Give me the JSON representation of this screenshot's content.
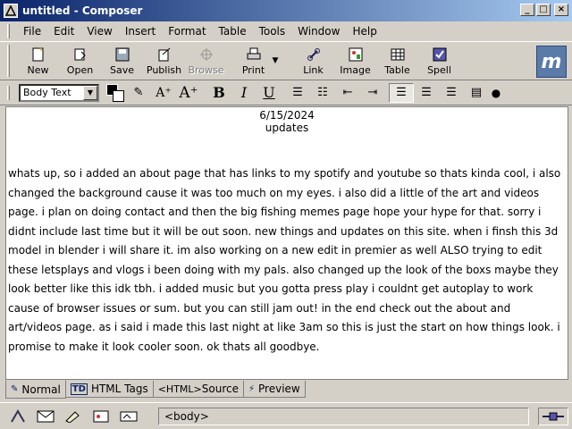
{
  "window": {
    "title": "untitled - Composer"
  },
  "menu": [
    "File",
    "Edit",
    "View",
    "Insert",
    "Format",
    "Table",
    "Tools",
    "Window",
    "Help"
  ],
  "toolbar": {
    "new": "New",
    "open": "Open",
    "save": "Save",
    "publish": "Publish",
    "browse": "Browse",
    "print": "Print",
    "link": "Link",
    "image": "Image",
    "table": "Table",
    "spell": "Spell"
  },
  "format_bar": {
    "paragraph_style": "Body Text"
  },
  "document": {
    "date": "6/15/2024",
    "heading": "updates",
    "body": "whats up, so i added an about page that has links to my spotify and youtube so thats kinda cool, i also changed the background cause it was too much on my eyes. i also did a little of the art and videos page. i plan on doing contact and then the big fishing memes page hope your hype for that. sorry i didnt include last time but it will be out soon. new things and updates on this site. when i finsh this 3d model in blender i will share it. im also working on a new edit in premier as well ALSO trying to edit these letsplays and vlogs i been doing with my pals. also changed up the look of the boxs maybe they look better like this idk tbh. i added music but you gotta press play i couldnt get autoplay to work cause of browser issues or sum. but you can still jam out! in the end check out the about and art/videos page. as i said i made this last night at like 3am so this is just the start on how things look. i promise to make it look cooler soon. ok thats all goodbye."
  },
  "tabs": {
    "normal": "Normal",
    "html_tags": "HTML Tags",
    "source": "Source",
    "preview": "Preview",
    "td_badge": "TD",
    "html_badge": "<HTML>"
  },
  "status": {
    "tag": "<body>"
  },
  "colors": {
    "title_start": "#0a246a",
    "title_end": "#a6caf0",
    "chrome": "#d4d0c8"
  }
}
